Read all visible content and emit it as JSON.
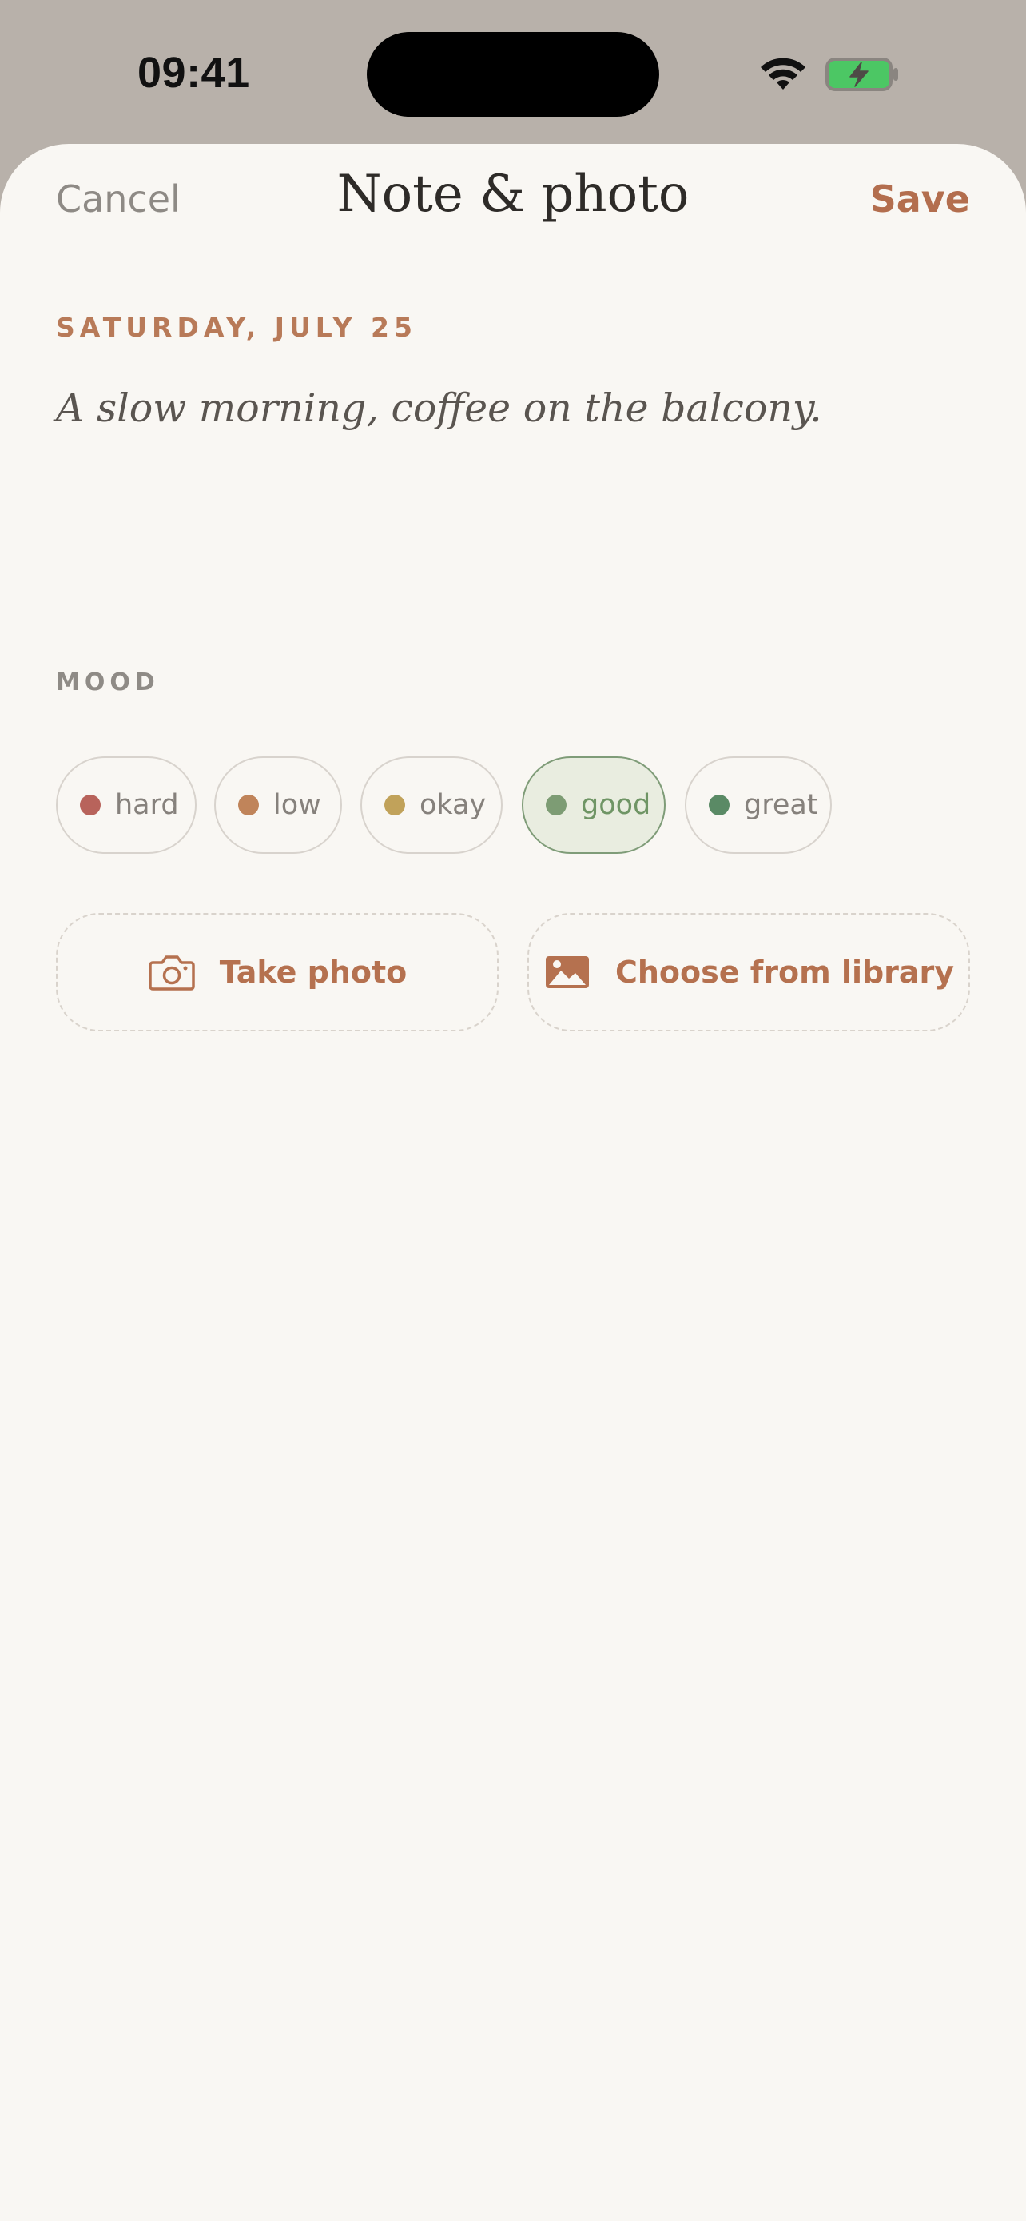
{
  "status_bar": {
    "time": "09:41"
  },
  "nav": {
    "cancel": "Cancel",
    "title": "Note & photo",
    "save": "Save"
  },
  "entry": {
    "date": "SATURDAY, JULY 25",
    "note": "A slow morning, coffee on the balcony."
  },
  "mood": {
    "label": "MOOD",
    "selected": "good",
    "options": [
      {
        "label": "hard",
        "color": "#b8635b"
      },
      {
        "label": "low",
        "color": "#c0845a"
      },
      {
        "label": "okay",
        "color": "#c1a25a"
      },
      {
        "label": "good",
        "color": "#7d9c74"
      },
      {
        "label": "great",
        "color": "#5a8a65"
      }
    ]
  },
  "actions": {
    "take_photo": {
      "label": "Take photo",
      "icon": "camera-icon"
    },
    "choose_library": {
      "label": "Choose from library",
      "icon": "image-icon"
    }
  },
  "colors": {
    "accent": "#b36e4e",
    "sheet_background": "#f9f7f3",
    "backdrop": "#b8b1aa",
    "selected_chip_fill": "#e9ede0",
    "selected_chip_border": "#7f9c78"
  }
}
